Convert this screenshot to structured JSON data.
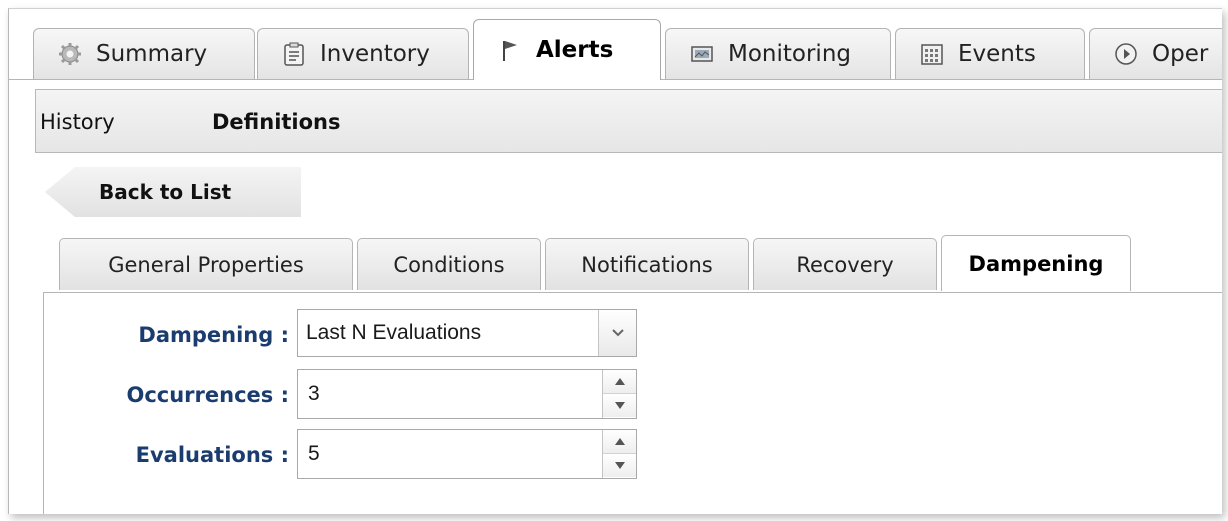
{
  "main_tabs": [
    {
      "label": "Summary",
      "icon": "gear-icon"
    },
    {
      "label": "Inventory",
      "icon": "clipboard-icon"
    },
    {
      "label": "Alerts",
      "icon": "flag-icon",
      "active": true
    },
    {
      "label": "Monitoring",
      "icon": "monitor-icon"
    },
    {
      "label": "Events",
      "icon": "calendar-grid-icon"
    },
    {
      "label": "Oper",
      "icon": "play-circle-icon"
    }
  ],
  "subnav": {
    "history": "History",
    "definitions": "Definitions"
  },
  "back_button": "Back to List",
  "inner_tabs": [
    "General Properties",
    "Conditions",
    "Notifications",
    "Recovery",
    "Dampening"
  ],
  "active_inner_tab": "Dampening",
  "form": {
    "dampening": {
      "label": "Dampening :",
      "value": "Last N Evaluations"
    },
    "occurrences": {
      "label": "Occurrences :",
      "value": "3"
    },
    "evaluations": {
      "label": "Evaluations :",
      "value": "5"
    }
  },
  "colors": {
    "label": "#1b3c6e",
    "tab_bg": "#e6e6e6",
    "border": "#b5b5b5"
  }
}
